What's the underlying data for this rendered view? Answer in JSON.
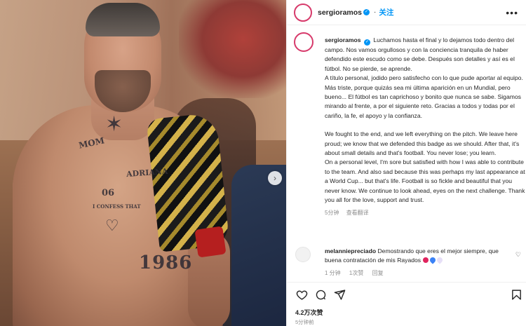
{
  "post": {
    "username": "sergioramos",
    "follow_label": "关注",
    "more_label": "•••",
    "caption": {
      "username": "sergioramos",
      "es_1": "Luchamos hasta el final y lo dejamos todo dentro del campo. Nos vamos orgullosos y con la conciencia tranquila de haber defendido este escudo como se debe. Después son detalles y así es el fútbol. No se pierde, se aprende.",
      "es_2": "A título personal, jodido pero satisfecho con lo que pude aportar al equipo. Más triste, porque quizás sea mi última aparición en un Mundial, pero bueno... El fútbol es tan caprichoso y bonito que nunca se sabe. Sigamos mirando al frente, a por el siguiente reto. Gracias a todos y todas por el cariño, la fe, el apoyo y la confianza.",
      "en_1": "We fought to the end, and we left everything on the pitch. We leave here proud; we know that we defended this badge as we should. After that, it's about small details and that's football. You never lose; you learn.",
      "en_2": "On a personal level, I'm sore but satisfied with how I was able to contribute to the team. And also sad because this was perhaps my last appearance at a World Cup... but that's life. Football is so fickle and beautiful that you never know. We continue to look ahead, eyes on the next challenge. Thank you all for the love, support and trust.",
      "time": "5分钟",
      "translate": "查看翻译"
    },
    "comment": {
      "username": "melanniepreciado",
      "text": "Demostrando que eres el mejor siempre, que buena contratación de mis Rayados",
      "time": "1 分钟",
      "likes": "1次赞",
      "reply": "回复"
    },
    "likes_text": "4.2万次赞",
    "post_time": "5分钟前"
  },
  "photo": {
    "tattoos": {
      "mom": "MOM",
      "adriana": "ADRIANA",
      "six": "06",
      "confess": "I CONFESS THAT",
      "year": "1986"
    }
  },
  "icons": {
    "verified": "verified-badge-icon",
    "more": "more-icon",
    "heart": "heart-icon",
    "comment": "comment-icon",
    "share": "share-icon",
    "save": "bookmark-icon",
    "next": "chevron-right-icon"
  },
  "colors": {
    "accent": "#0095f6",
    "story_ring": "#d73a6b",
    "muted": "#8e8e8e"
  }
}
